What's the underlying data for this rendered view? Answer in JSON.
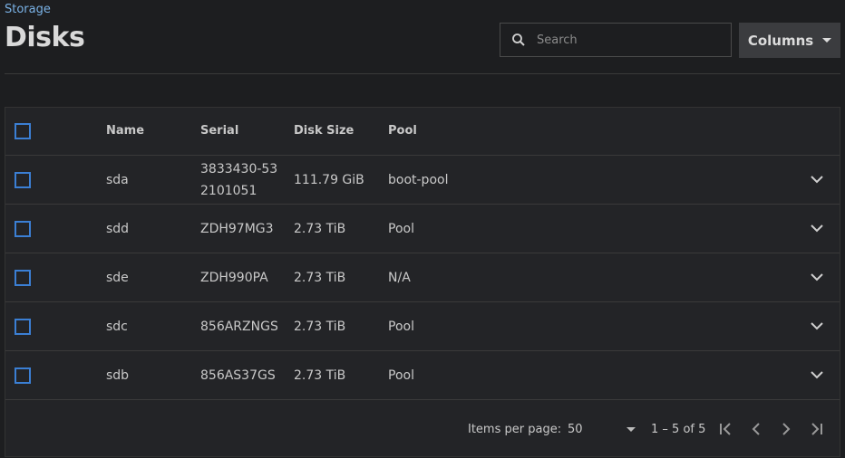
{
  "breadcrumb": "Storage",
  "title": "Disks",
  "search": {
    "placeholder": "Search",
    "value": ""
  },
  "columns_button": {
    "label": "Columns"
  },
  "table": {
    "headers": {
      "name": "Name",
      "serial": "Serial",
      "size": "Disk Size",
      "pool": "Pool"
    },
    "rows": [
      {
        "name": "sda",
        "serial": "3833430-532101051",
        "size": "111.79 GiB",
        "pool": "boot-pool"
      },
      {
        "name": "sdd",
        "serial": "ZDH97MG3",
        "size": "2.73 TiB",
        "pool": "Pool"
      },
      {
        "name": "sde",
        "serial": "ZDH990PA",
        "size": "2.73 TiB",
        "pool": "N/A"
      },
      {
        "name": "sdc",
        "serial": "856ARZNGS",
        "size": "2.73 TiB",
        "pool": "Pool"
      },
      {
        "name": "sdb",
        "serial": "856AS37GS",
        "size": "2.73 TiB",
        "pool": "Pool"
      }
    ]
  },
  "paginator": {
    "items_per_page_label": "Items per page:",
    "items_per_page": "50",
    "range": "1 – 5 of 5"
  },
  "colors": {
    "accent": "#3b7fd4",
    "link": "#7ab2e6",
    "background": "#1d1e20"
  }
}
